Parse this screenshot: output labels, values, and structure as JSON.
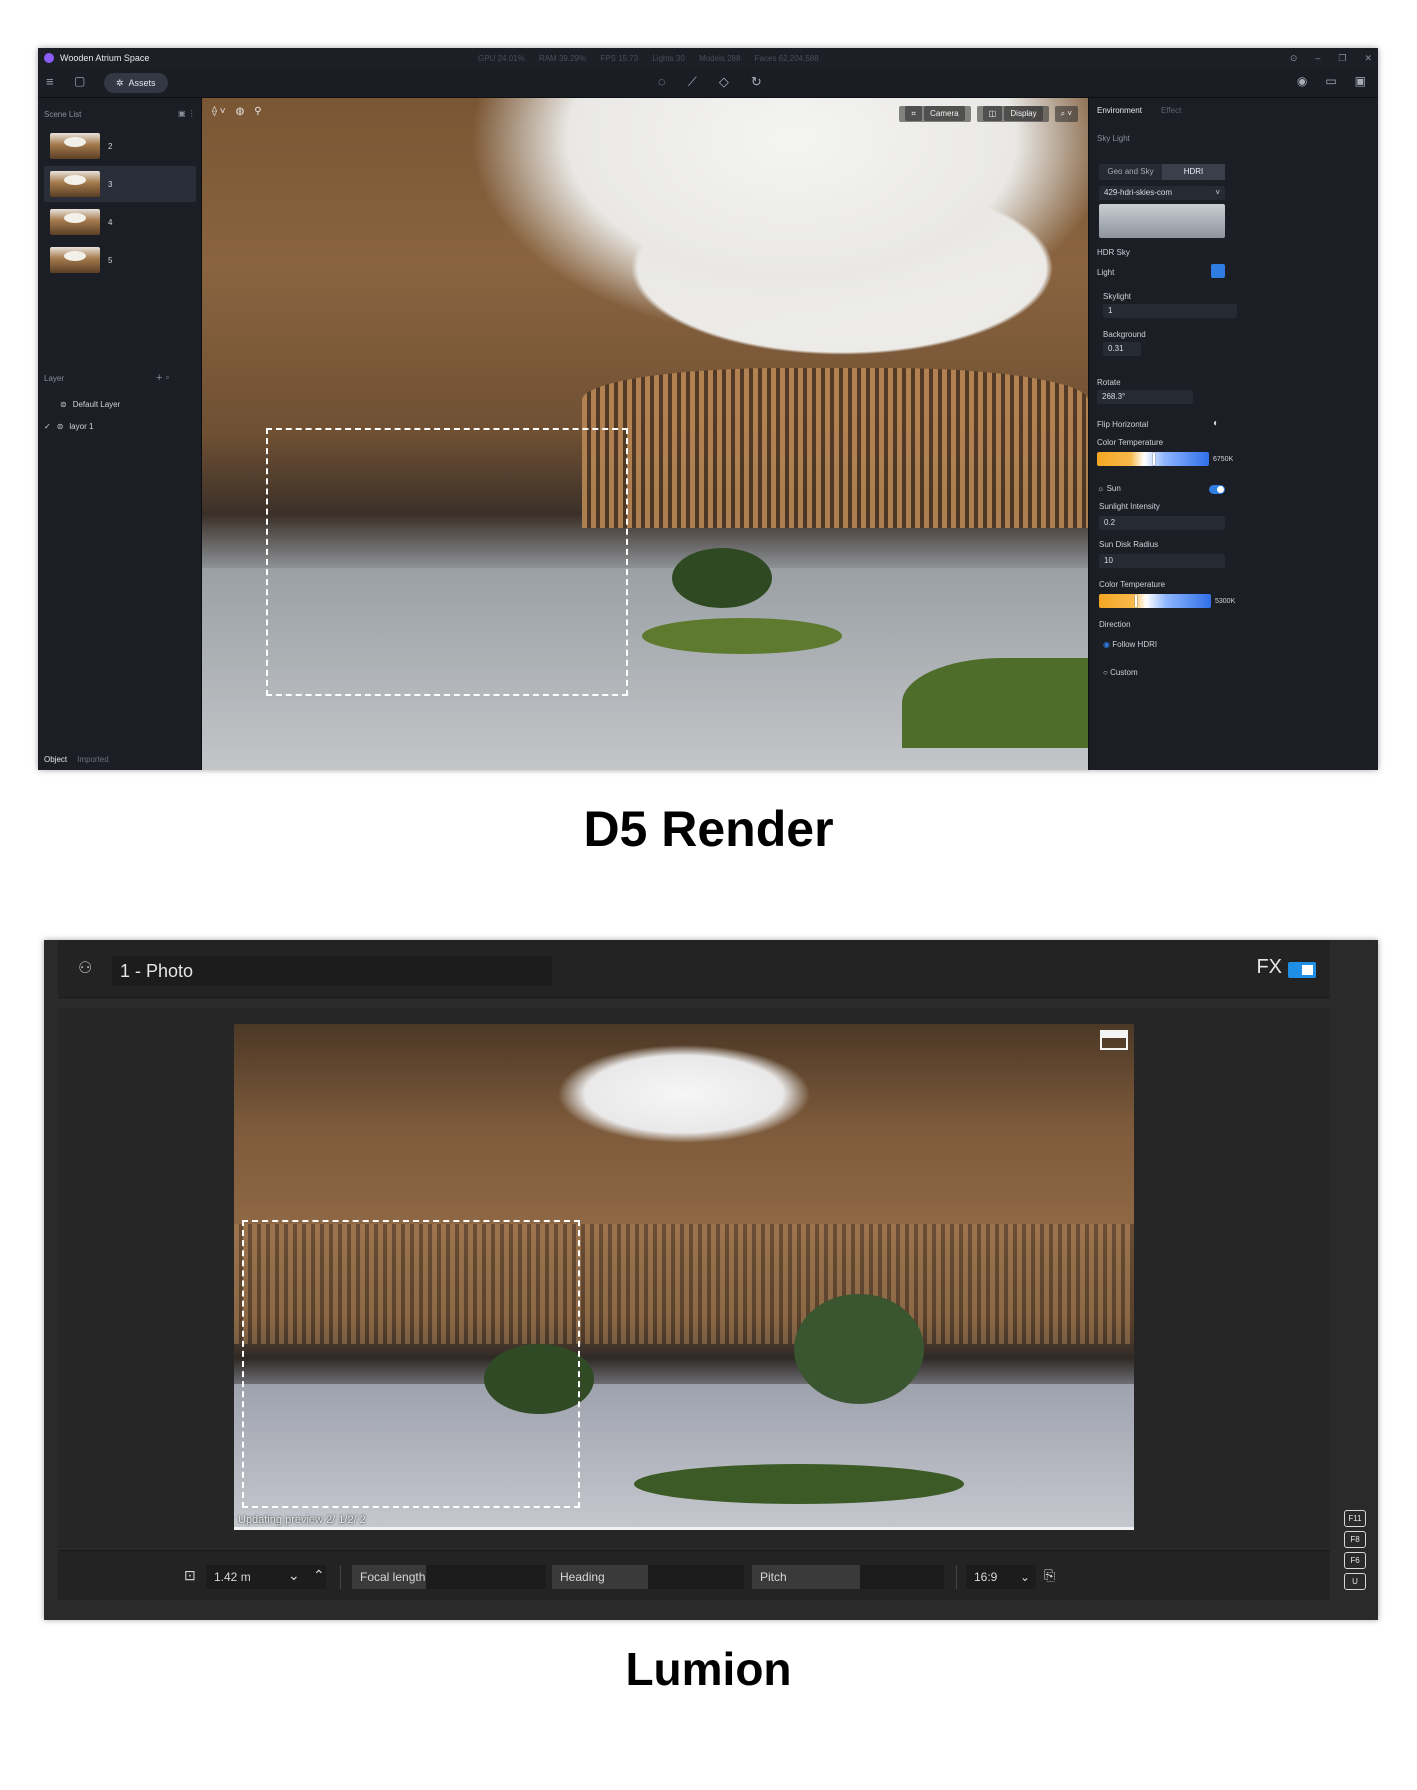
{
  "d5": {
    "title": "Wooden Atrium Space",
    "stats": [
      "GPU 24.01%",
      "RAM 39.29%",
      "FPS 15.73",
      "Lights 30",
      "Models 288",
      "Faces 62,204,588"
    ],
    "assets_label": "Assets",
    "scene_list_label": "Scene List",
    "scenes": [
      "2",
      "3",
      "4",
      "5"
    ],
    "layer_label": "Layer",
    "layers": [
      "Default Layer",
      "layor 1"
    ],
    "object_tab": "Object",
    "imported_tab": "Imported",
    "viewport": {
      "camera_label": "Camera",
      "display_label": "Display"
    },
    "right": {
      "tab_environment": "Environment",
      "tab_effect": "Effect",
      "sky_light": "Sky Light",
      "seg_geo": "Geo and Sky",
      "seg_hdri": "HDRI",
      "hdri_name": "429-hdri-skies-com",
      "hdr_sky": "HDR Sky",
      "light": "Light",
      "skylight": "Skylight",
      "skylight_value": "1",
      "background": "Background",
      "background_value": "0.31",
      "rotate": "Rotate",
      "rotate_value": "268.3°",
      "flip_horizontal": "Flip Horizontal",
      "color_temperature": "Color Temperature",
      "color_temp_value": "6750K",
      "sun": "Sun",
      "sunlight_intensity": "Sunlight Intensity",
      "sunlight_intensity_value": "0.2",
      "sun_disk_radius": "Sun Disk Radius",
      "sun_disk_radius_value": "10",
      "color_temperature_2": "Color Temperature",
      "color_temp_value_2": "5300K",
      "direction": "Direction",
      "follow_hdri": "Follow HDRI",
      "custom": "Custom"
    }
  },
  "captions": {
    "d5": "D5 Render",
    "lumion": "Lumion"
  },
  "lumion": {
    "photo_name": "1 - Photo",
    "fx_label": "FX",
    "status": "Updating preview 2/ 1/2/ 2",
    "progress": 1.0,
    "height_value": "1.42 m",
    "focal_length": "Focal length",
    "heading": "Heading",
    "pitch": "Pitch",
    "aspect": "16:9",
    "keys": [
      "F11",
      "F8",
      "F6",
      "U"
    ]
  },
  "colors": {
    "accent_blue": "#2f7de1",
    "lumion_toggle": "#1f8fe6"
  }
}
